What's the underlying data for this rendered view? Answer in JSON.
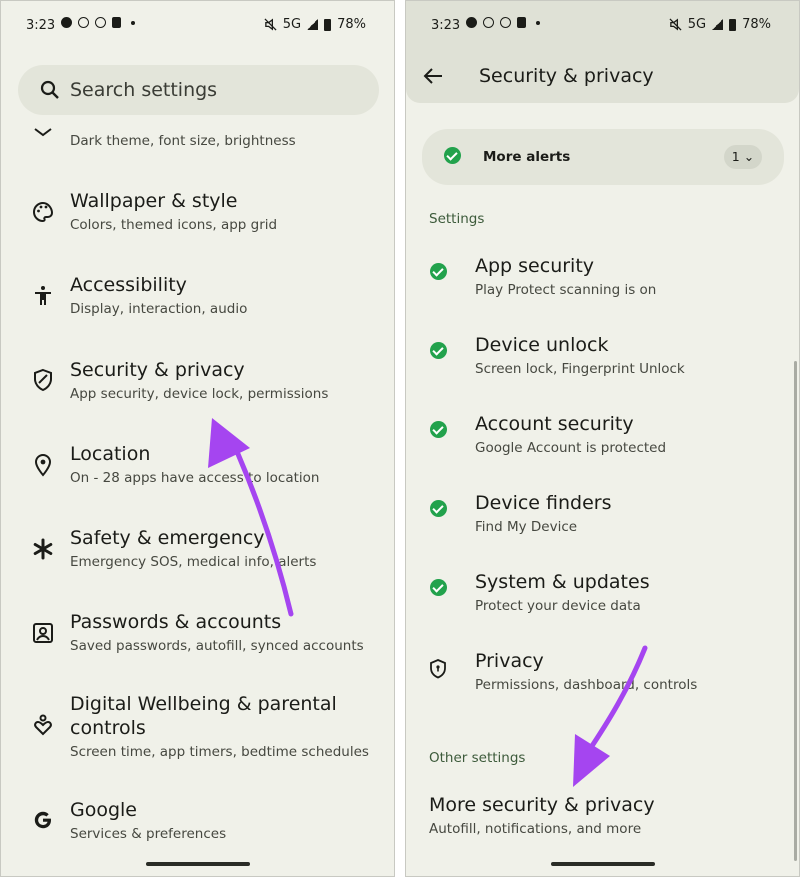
{
  "left": {
    "status": {
      "time": "3:23",
      "network": "5G",
      "battery": "78%"
    },
    "search": {
      "placeholder": "Search settings"
    },
    "items": [
      {
        "title": "",
        "sub": "Dark theme, font size, brightness",
        "icon": "display-icon"
      },
      {
        "title": "Wallpaper & style",
        "sub": "Colors, themed icons, app grid",
        "icon": "palette-icon"
      },
      {
        "title": "Accessibility",
        "sub": "Display, interaction, audio",
        "icon": "accessibility-icon"
      },
      {
        "title": "Security & privacy",
        "sub": "App security, device lock, permissions",
        "icon": "shield-icon"
      },
      {
        "title": "Location",
        "sub": "On - 28 apps have access to location",
        "icon": "location-pin-icon"
      },
      {
        "title": "Safety & emergency",
        "sub": "Emergency SOS, medical info, alerts",
        "icon": "asterisk-icon"
      },
      {
        "title": "Passwords & accounts",
        "sub": "Saved passwords, autofill, synced accounts",
        "icon": "account-box-icon"
      },
      {
        "title": "Digital Wellbeing & parental",
        "title2": "controls",
        "sub": "Screen time, app timers, bedtime schedules",
        "icon": "wellbeing-icon"
      },
      {
        "title": "Google",
        "sub": "Services & preferences",
        "icon": "google-icon"
      }
    ]
  },
  "right": {
    "status": {
      "time": "3:23",
      "network": "5G",
      "battery": "78%"
    },
    "header": {
      "title": "Security & privacy"
    },
    "alert": {
      "label": "More alerts",
      "count": "1"
    },
    "sections": {
      "settings": "Settings",
      "other": "Other settings"
    },
    "items": [
      {
        "title": "App security",
        "sub": "Play Protect scanning is on",
        "icon": "check-circle-icon"
      },
      {
        "title": "Device unlock",
        "sub": "Screen lock, Fingerprint Unlock",
        "icon": "check-circle-icon"
      },
      {
        "title": "Account security",
        "sub": "Google Account is protected",
        "icon": "check-circle-icon"
      },
      {
        "title": "Device finders",
        "sub": "Find My Device",
        "icon": "check-circle-icon"
      },
      {
        "title": "System & updates",
        "sub": "Protect your device data",
        "icon": "check-circle-icon"
      },
      {
        "title": "Privacy",
        "sub": "Permissions, dashboard, controls",
        "icon": "privacy-shield-icon"
      }
    ],
    "more": {
      "title": "More security & privacy",
      "sub": "Autofill, notifications, and more"
    }
  },
  "colors": {
    "background": "#f0f1e9",
    "accent_arrow": "#a545f0",
    "check_green": "#22a24c"
  }
}
